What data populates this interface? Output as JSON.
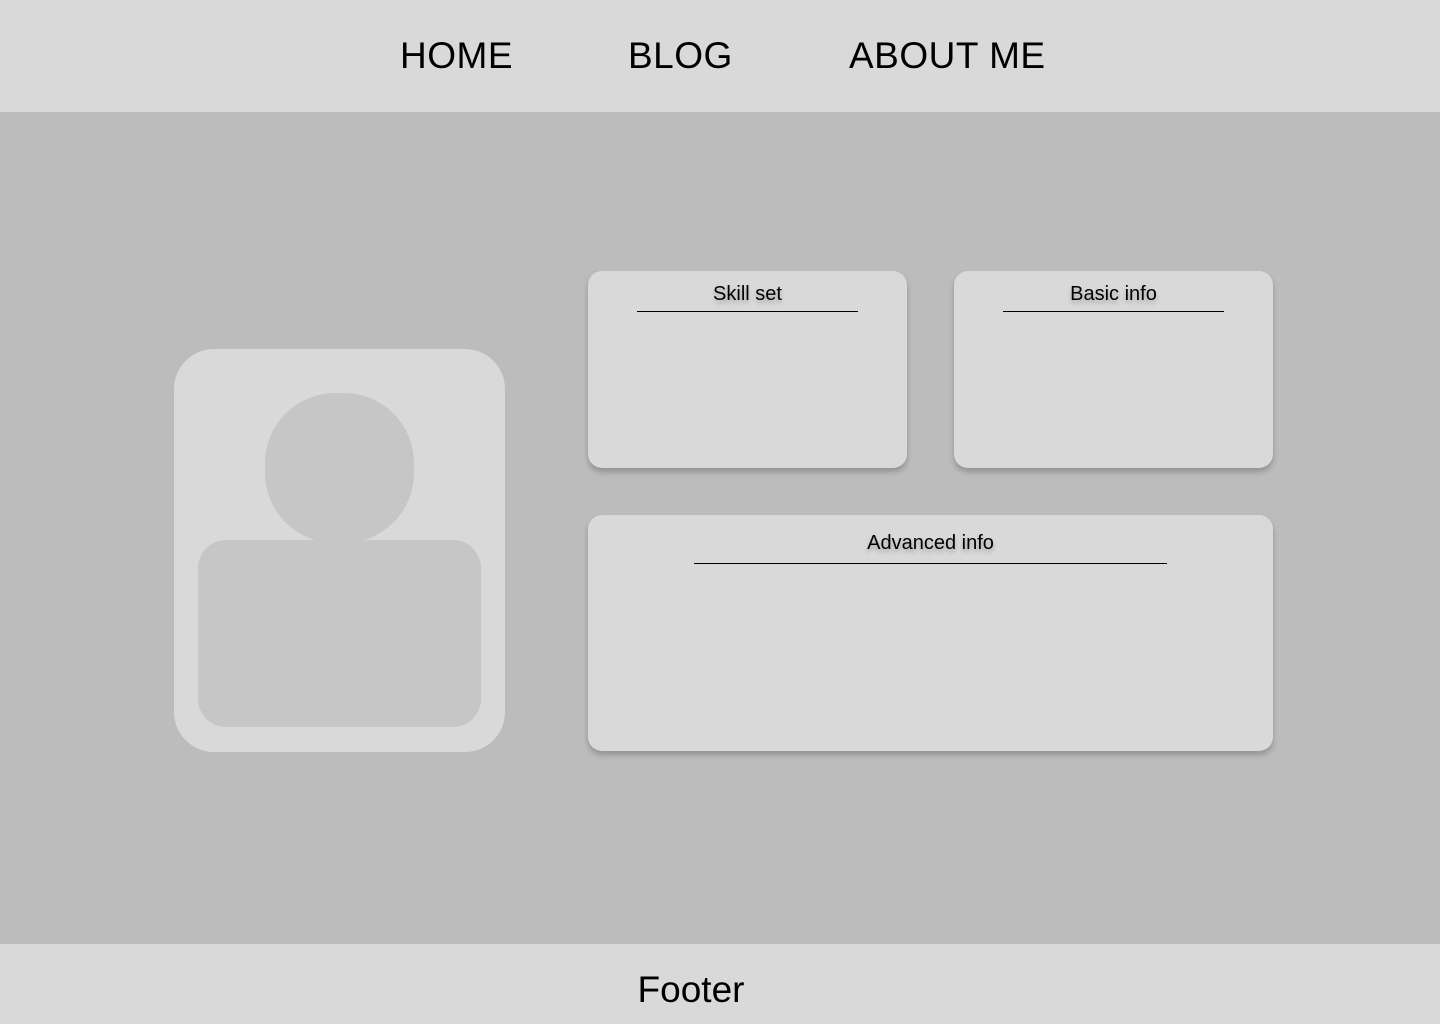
{
  "nav": {
    "items": [
      {
        "label": "HOME"
      },
      {
        "label": "BLOG"
      },
      {
        "label": "ABOUT ME"
      }
    ]
  },
  "profile": {
    "avatar_icon": "user-placeholder-icon"
  },
  "cards": {
    "skill": {
      "title": "Skill set"
    },
    "basic": {
      "title": "Basic info"
    },
    "advanced": {
      "title": "Advanced info"
    }
  },
  "footer": {
    "text": "Footer"
  },
  "colors": {
    "bar_bg": "#d9d9d9",
    "page_bg": "#bcbcbc",
    "card_bg": "#d9d9d9",
    "avatar_shape": "#c7c6c6",
    "text": "#000000"
  }
}
